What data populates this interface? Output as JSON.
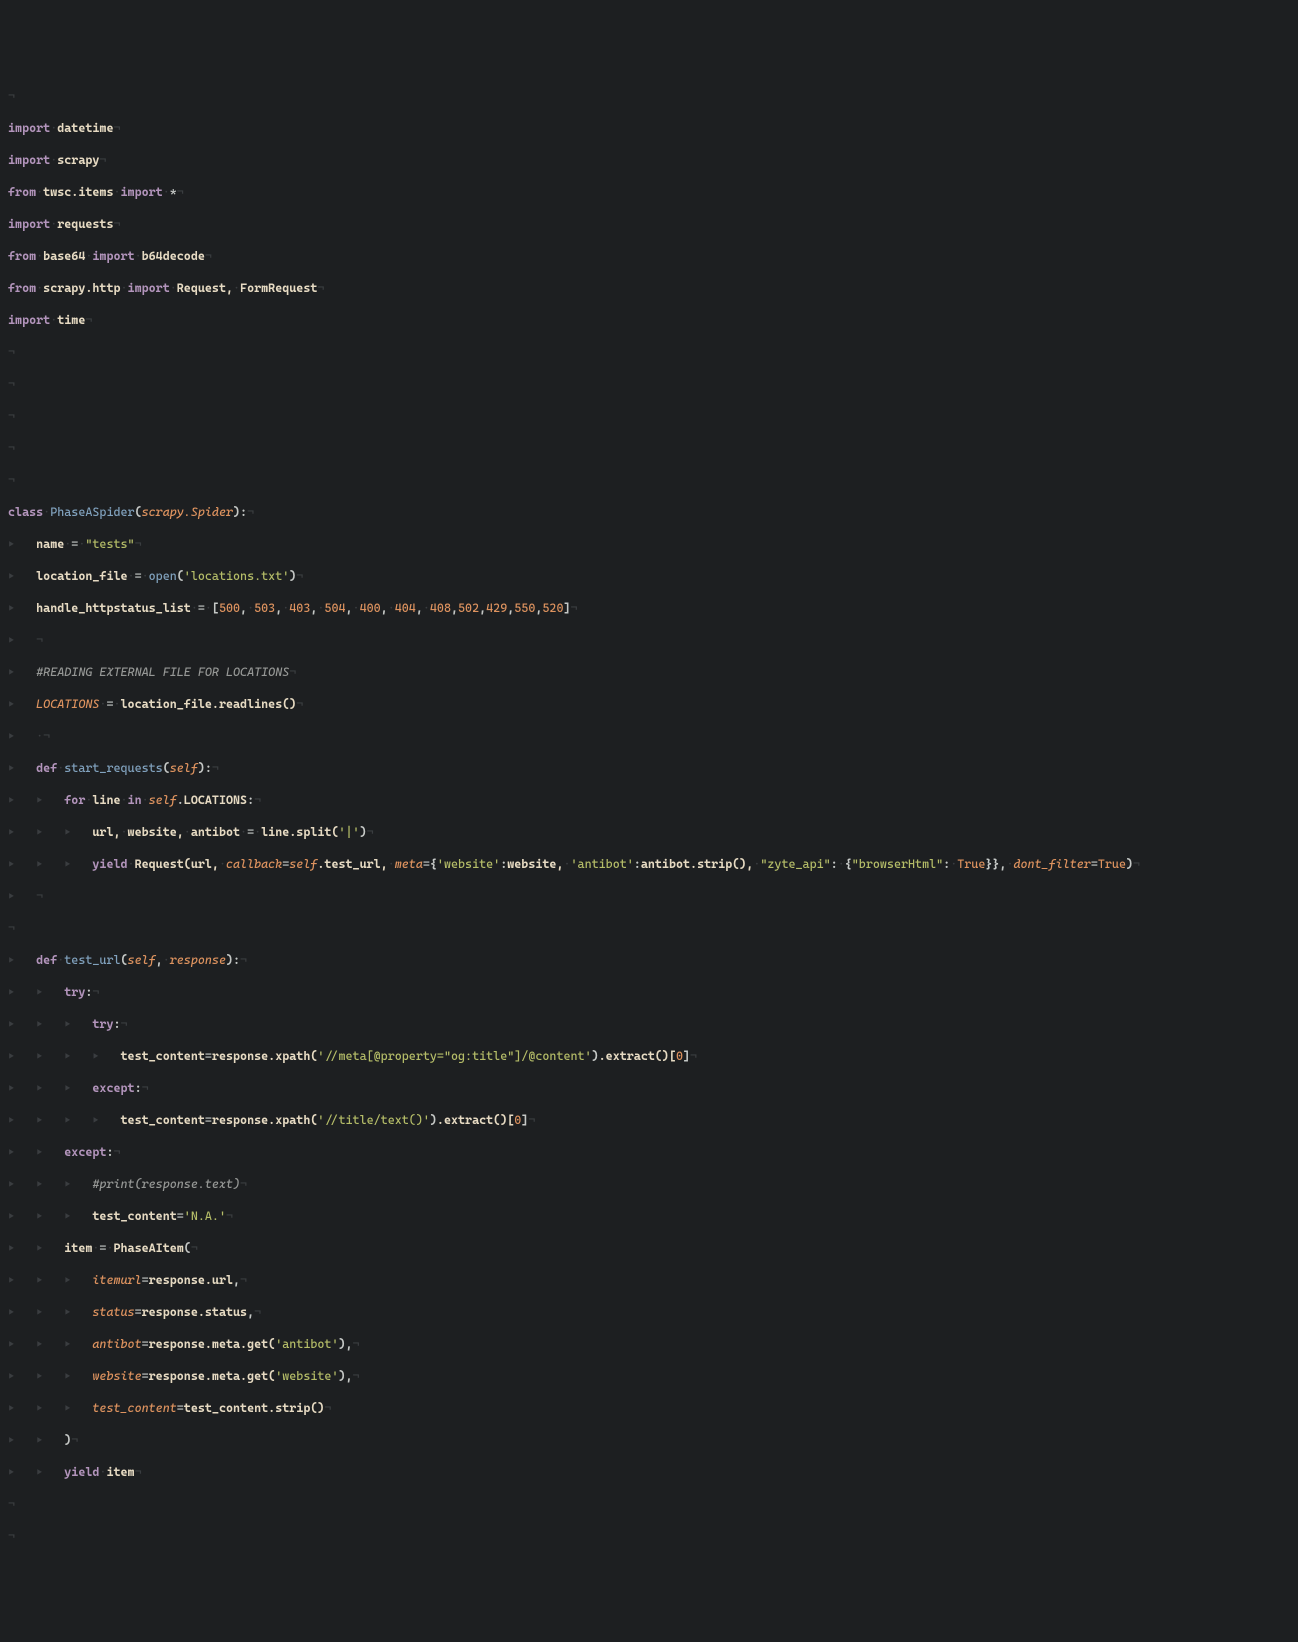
{
  "editor": {
    "language": "python",
    "whitespace_markers": {
      "newline": "¬",
      "tab": "▸",
      "space": "·"
    },
    "colors": {
      "background": "#1d1f21",
      "keyword": "#b294bb",
      "identifier": "#e6dac2",
      "function": "#81a2be",
      "parameter": "#de935f",
      "string": "#b5bd68",
      "number": "#de935f",
      "boolean": "#de935f",
      "comment": "#969896",
      "whitespace": "#3a3d40"
    },
    "code": {
      "imports": [
        "import datetime",
        "import scrapy",
        "from twsc.items import *",
        "import requests",
        "from base64 import b64decode",
        "from scrapy.http import Request, FormRequest",
        "import time"
      ],
      "class_name": "PhaseASpider",
      "class_base": "scrapy.Spider",
      "name_value": "\"tests\"",
      "location_file_open_arg": "'locations.txt'",
      "handle_httpstatus_list": [
        500,
        503,
        403,
        504,
        400,
        404,
        408,
        502,
        429,
        550,
        520
      ],
      "comment_reading": "#READING EXTERNAL FILE FOR LOCATIONS",
      "start_requests": {
        "def": "def start_requests(self):",
        "for": "for line in self.LOCATIONS:",
        "split": "url, website, antibot = line.split('|')",
        "yield_call": "yield Request(url, callback=self.test_url, meta={'website':website, 'antibot':antibot.strip(), \"zyte_api\": {\"browserHtml\": True}}, dont_filter=True)"
      },
      "test_url": {
        "def": "def test_url(self, response):",
        "xpath1": "'//meta[@property=\"og:title\"]/@content'",
        "xpath2": "'//title/text()'",
        "comment_print": "#print(response.text)",
        "na_value": "'N.A.'",
        "item_class": "PhaseAItem",
        "item_fields": {
          "itemurl": "response.url",
          "status": "response.status",
          "antibot": "response.meta.get('antibot')",
          "website": "response.meta.get('website')",
          "test_content": "test_content.strip()"
        }
      }
    }
  }
}
